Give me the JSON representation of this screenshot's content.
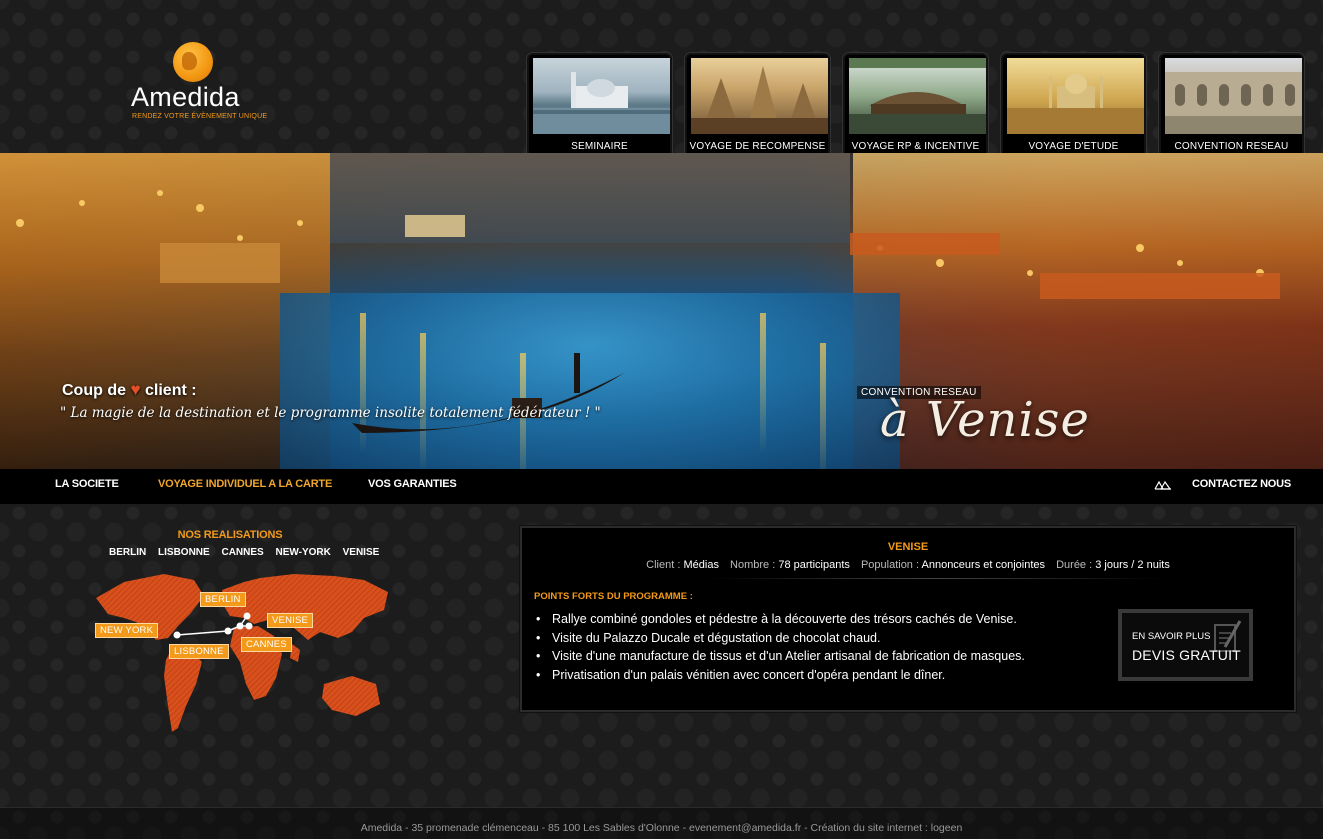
{
  "logo": {
    "name": "Amedida",
    "tagline": "RENDEZ VOTRE ÉVÈNEMENT UNIQUE"
  },
  "categories": [
    {
      "label": "SEMINAIRE"
    },
    {
      "label": "VOYAGE DE RECOMPENSE"
    },
    {
      "label": "VOYAGE RP & INCENTIVE"
    },
    {
      "label": "VOYAGE D'ETUDE"
    },
    {
      "label": "CONVENTION RESEAU"
    }
  ],
  "hero": {
    "quote_title_pre": "Coup de",
    "quote_title_post": "client :",
    "quote": "\" La magie de la destination et le programme insolite totalement fédérateur ! \"",
    "subtitle": "CONVENTION RESEAU",
    "destination": "à Venise"
  },
  "nav": {
    "items": [
      "LA SOCIETE",
      "VOYAGE INDIVIDUEL A LA CARTE",
      "VOS GARANTIES"
    ],
    "contact": "CONTACTEZ NOUS",
    "active_color": "#f0a62c"
  },
  "realisations": {
    "title": "NOS REALISATIONS",
    "cities": [
      "BERLIN",
      "LISBONNE",
      "CANNES",
      "NEW-YORK",
      "VENISE"
    ],
    "map_labels": {
      "berlin": "BERLIN",
      "venise": "VENISE",
      "newyork": "NEW YORK",
      "lisbonne": "LISBONNE",
      "cannes": "CANNES"
    },
    "map_color": "#d9501d"
  },
  "panel": {
    "title": "VENISE",
    "client_k": "Client :",
    "client_v": "Médias",
    "nombre_k": "Nombre :",
    "nombre_v": "78 participants",
    "population_k": "Population :",
    "population_v": "Annonceurs et conjointes",
    "duree_k": "Durée :",
    "duree_v": "3 jours / 2 nuits",
    "points_title": "POINTS FORTS DU PROGRAMME :",
    "points": [
      "Rallye combiné gondoles et pédestre à la découverte des trésors cachés de Venise.",
      "Visite du Palazzo Ducale et dégustation de chocolat chaud.",
      "Visite d'une manufacture de tissus et d'un Atelier artisanal de fabrication de masques.",
      "Privatisation d'un palais vénitien avec concert d'opéra pendant le dîner."
    ],
    "devis_l1": "EN SAVOIR PLUS",
    "devis_l2": "DEVIS GRATUIT"
  },
  "footer": {
    "text": "Amedida - 35 promenade clémenceau - 85 100 Les Sables d'Olonne - evenement@amedida.fr - Création du site internet : logeen"
  },
  "colors": {
    "accent": "#f39a1a",
    "background": "#1c1c1c"
  }
}
